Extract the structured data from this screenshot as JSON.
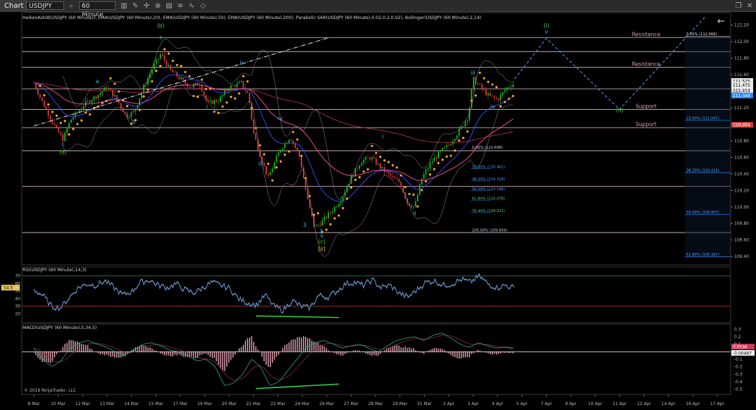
{
  "toolbar": {
    "tab": "Chart",
    "instrument": "USDJPY",
    "interval": "60 Minute",
    "icons": [
      "search-icon",
      "settings-icon",
      "bar-style-icon",
      "draw-icon",
      "crosshair-icon",
      "zoom-icon",
      "template-icon",
      "properties-icon",
      "indicator-icon",
      "strategy-icon",
      "window-icon",
      "close-icon"
    ]
  },
  "colors": {
    "background": "#000000",
    "up": "#1fb81f",
    "down": "#d83a3a",
    "sar": "#f4a62a",
    "ema20": "#3e4cff",
    "ema50": "#ff4f9b",
    "ema200": "#a5334a",
    "bollinger": "#bdbdbd",
    "level": "#f0c8d0",
    "fib_left": "#2f8cff",
    "fib_right": "#2f8cff",
    "projection": "#5f9bff",
    "wave_green": "#3fd23f",
    "wave_cyan": "#33c3e0",
    "wave_yellow": "#e0d23a",
    "rsi": "#4a8fe0",
    "divergence": "#39e04a"
  },
  "chart_data": [
    {
      "type": "candlestick",
      "title": "HeikenAshi8(USDJPY (60 Minute)), EMA(USDJPY (60 Minute),20), EMA(USDJPY (60 Minute),50), EMA(USDJPY (60 Minute),200), Parabolic SAR(USDJPY (60 Minute),0.02,0.2,0.02), Bollinger(USDJPY (60 Minute),2,14)",
      "xlabel": "",
      "ylabel": "",
      "x_ticks": [
        "8 Mar",
        "10 Mar",
        "12 Mar",
        "13 Mar",
        "14 Mar",
        "15 Mar",
        "17 Mar",
        "19 Mar",
        "20 Mar",
        "21 Mar",
        "22 Mar",
        "24 Mar",
        "26 Mar",
        "27 Mar",
        "28 Mar",
        "29 Mar",
        "31 Mar",
        "2 Apr",
        "3 Apr",
        "4 Apr",
        "5 Apr",
        "7 Apr",
        "9 Apr",
        "10 Apr",
        "11 Apr",
        "12 Apr",
        "14 Apr",
        "16 Apr",
        "17 Apr"
      ],
      "y_ticks": [
        112.2,
        112.0,
        111.8,
        111.6,
        111.4,
        111.2,
        111.0,
        110.8,
        110.6,
        110.4,
        110.2,
        110.0,
        109.8,
        109.6,
        109.4
      ],
      "ylim": [
        109.35,
        112.3
      ],
      "price_path": [
        [
          0,
          111.5
        ],
        [
          0.3,
          111.3
        ],
        [
          0.9,
          110.95
        ],
        [
          1.2,
          110.82
        ],
        [
          1.5,
          111.05
        ],
        [
          2.1,
          111.25
        ],
        [
          2.6,
          111.35
        ],
        [
          3.0,
          111.45
        ],
        [
          3.4,
          111.3
        ],
        [
          3.8,
          111.1
        ],
        [
          4.1,
          111.15
        ],
        [
          4.5,
          111.45
        ],
        [
          4.9,
          111.7
        ],
        [
          5.2,
          111.85
        ],
        [
          5.6,
          111.65
        ],
        [
          6.0,
          111.55
        ],
        [
          6.4,
          111.45
        ],
        [
          6.8,
          111.5
        ],
        [
          7.1,
          111.25
        ],
        [
          7.6,
          111.3
        ],
        [
          8.0,
          111.45
        ],
        [
          8.5,
          111.5
        ],
        [
          8.8,
          111.35
        ],
        [
          9.0,
          110.9
        ],
        [
          9.3,
          110.6
        ],
        [
          9.6,
          110.35
        ],
        [
          10.1,
          110.7
        ],
        [
          10.5,
          110.85
        ],
        [
          10.9,
          110.6
        ],
        [
          11.2,
          110.1
        ],
        [
          11.5,
          109.75
        ],
        [
          11.8,
          109.82
        ],
        [
          12.2,
          109.95
        ],
        [
          12.6,
          110.1
        ],
        [
          13.0,
          110.35
        ],
        [
          13.4,
          110.55
        ],
        [
          13.8,
          110.6
        ],
        [
          14.3,
          110.45
        ],
        [
          14.7,
          110.35
        ],
        [
          15.0,
          110.3
        ],
        [
          15.3,
          110.05
        ],
        [
          15.6,
          110.0
        ],
        [
          15.9,
          110.35
        ],
        [
          16.3,
          110.55
        ],
        [
          16.6,
          110.65
        ],
        [
          17.0,
          110.75
        ],
        [
          17.5,
          110.95
        ],
        [
          17.8,
          111.1
        ],
        [
          18.0,
          111.55
        ],
        [
          18.3,
          111.45
        ],
        [
          18.6,
          111.35
        ],
        [
          19.0,
          111.3
        ],
        [
          19.4,
          111.45
        ],
        [
          19.7,
          111.5
        ]
      ],
      "series": [
        {
          "name": "EMA 20",
          "values_ref": "price_path",
          "smoothing": 20
        },
        {
          "name": "EMA 50",
          "values_ref": "price_path",
          "smoothing": 50
        },
        {
          "name": "EMA 200",
          "values_ref": "price_path",
          "smoothing": 200
        }
      ],
      "projection": [
        [
          19.7,
          111.55
        ],
        [
          21.0,
          112.04
        ],
        [
          24.0,
          111.18
        ],
        [
          27.5,
          112.3
        ]
      ],
      "trendline": [
        [
          0,
          110.98
        ],
        [
          12.1,
          112.05
        ]
      ],
      "right_axis_labels": [
        {
          "text": "111.525",
          "value": 111.525,
          "color": "#ffffff"
        },
        {
          "text": "111.475",
          "value": 111.475,
          "color": "#ffffff"
        },
        {
          "text": "111.414",
          "value": 111.414,
          "color": "#ffffff"
        },
        {
          "text": "111.349",
          "value": 111.349,
          "color": "#2f8cff"
        },
        {
          "text": "110.994",
          "value": 110.994,
          "color": "#d83a3a"
        }
      ],
      "levels": [
        {
          "value": 112.05,
          "label": ""
        },
        {
          "value": 111.88,
          "label": ""
        },
        {
          "value": 111.69,
          "label": "Resistance"
        },
        {
          "value": 111.43,
          "label": ""
        },
        {
          "value": 111.18,
          "label": "Support"
        },
        {
          "value": 110.96,
          "label": "Support"
        },
        {
          "value": 110.68,
          "label": ""
        },
        {
          "value": 110.25,
          "label": ""
        },
        {
          "value": 109.69,
          "label": ""
        }
      ],
      "level_text": [
        {
          "text": "Resistance",
          "value": 112.05
        },
        {
          "text": "Resistance",
          "value": 111.69
        },
        {
          "text": "Support",
          "value": 111.18
        },
        {
          "text": "Support",
          "value": 110.96
        }
      ],
      "fib_left": [
        {
          "text": "0.00% (110.698)",
          "value": 110.698
        },
        {
          "text": "23.60% (110.461)",
          "value": 110.461
        },
        {
          "text": "38.20% (110.314)",
          "value": 110.314
        },
        {
          "text": "50.00% (110.196)",
          "value": 110.196
        },
        {
          "text": "61.80% (110.078)",
          "value": 110.078
        },
        {
          "text": "76.40% (109.931)",
          "value": 109.931
        },
        {
          "text": "100.00% (109.694)",
          "value": 109.694
        }
      ],
      "fib_right": [
        {
          "text": "0.00% (112.066)",
          "value": 112.066
        },
        {
          "text": "23.60% (111.047)",
          "value": 111.047
        },
        {
          "text": "38.20% (110.416)",
          "value": 110.416
        },
        {
          "text": "50.00% (109.907)",
          "value": 109.907
        },
        {
          "text": "61.80% (109.397)",
          "value": 109.397
        }
      ],
      "wave_labels": [
        {
          "text": "(b)",
          "x": 5.2,
          "value": 112.17,
          "color": "#3fd23f"
        },
        {
          "text": "c",
          "x": 5.2,
          "value": 112.03,
          "color": "#33c3e0"
        },
        {
          "text": "a",
          "x": 2.6,
          "value": 111.5,
          "color": "#33c3e0"
        },
        {
          "text": "b",
          "x": 4.1,
          "value": 111.01,
          "color": "#33c3e0"
        },
        {
          "text": "c",
          "x": 1.2,
          "value": 110.74,
          "color": "#33c3e0"
        },
        {
          "text": "(a)",
          "x": 1.2,
          "value": 110.64,
          "color": "#3fd23f"
        },
        {
          "text": "ii",
          "x": 8.5,
          "value": 111.72,
          "color": "#33c3e0"
        },
        {
          "text": "i",
          "x": 7.1,
          "value": 111.19,
          "color": "#33c3e0"
        },
        {
          "text": "iii",
          "x": 9.3,
          "value": 110.5,
          "color": "#33c3e0"
        },
        {
          "text": "iv",
          "x": 10.1,
          "value": 111.05,
          "color": "#33c3e0"
        },
        {
          "text": "3",
          "x": 11.1,
          "value": 109.76,
          "color": "#33c3e0"
        },
        {
          "text": "5",
          "x": 11.8,
          "value": 109.68,
          "color": "#33c3e0"
        },
        {
          "text": "v",
          "x": 11.8,
          "value": 109.63,
          "color": "#33c3e0"
        },
        {
          "text": "(c)",
          "x": 11.8,
          "value": 109.56,
          "color": "#3fd23f"
        },
        {
          "text": "[ii]",
          "x": 11.8,
          "value": 109.47,
          "color": "#e0d23a"
        },
        {
          "text": "i",
          "x": 14.3,
          "value": 110.83,
          "color": "#33c3e0"
        },
        {
          "text": "ii",
          "x": 15.6,
          "value": 109.9,
          "color": "#33c3e0"
        },
        {
          "text": "iii",
          "x": 18.0,
          "value": 111.6,
          "color": "#33c3e0"
        },
        {
          "text": "iv",
          "x": 18.8,
          "value": 111.19,
          "color": "#33c3e0"
        },
        {
          "text": "(i)",
          "x": 21.0,
          "value": 112.17,
          "color": "#3fd23f"
        },
        {
          "text": "v",
          "x": 21.0,
          "value": 112.1,
          "color": "#33c3e0"
        },
        {
          "text": "(ii)",
          "x": 24.0,
          "value": 111.15,
          "color": "#3fd23f"
        }
      ]
    },
    {
      "type": "line",
      "title": "RSI(USDJPY (60 Minute),14,3)",
      "y_ticks": [
        70,
        60,
        50,
        40,
        30,
        20
      ],
      "ylim": [
        10,
        80
      ],
      "current_value": "54.5",
      "series": [
        {
          "name": "RSI",
          "values": [
            52,
            45,
            30,
            28,
            42,
            55,
            60,
            58,
            64,
            55,
            45,
            50,
            62,
            65,
            58,
            55,
            60,
            52,
            48,
            55,
            62,
            58,
            54,
            40,
            35,
            32,
            45,
            30,
            25,
            38,
            30,
            28,
            45,
            42,
            50,
            60,
            62,
            58,
            65,
            55,
            58,
            48,
            42,
            52,
            62,
            64,
            58,
            60,
            66,
            62,
            70,
            60,
            55,
            58,
            54
          ]
        }
      ],
      "overbought": 70,
      "oversold": 30,
      "divergence_line": {
        "from": [
          9.1,
          17
        ],
        "to": [
          12.5,
          15
        ]
      }
    },
    {
      "type": "bar",
      "title": "MACD(USDJPY (60 Minute),5,34,5)",
      "y_ticks": [
        0.3,
        0.2,
        0.1,
        0,
        -0.1,
        -0.2,
        -0.3,
        -0.4,
        -0.5
      ],
      "ylim": [
        -0.55,
        0.35
      ],
      "current_values": [
        "0.0596",
        "-0.00467"
      ],
      "series": [
        {
          "name": "MACD",
          "values": [
            0.05,
            -0.1,
            -0.2,
            -0.12,
            0.05,
            0.12,
            0.15,
            0.1,
            0.06,
            0.0,
            -0.05,
            0.02,
            0.1,
            0.12,
            0.08,
            0.02,
            0.0,
            -0.06,
            -0.12,
            -0.1,
            -0.2,
            -0.45,
            -0.42,
            -0.3,
            -0.1,
            -0.2,
            -0.45,
            -0.4,
            -0.25,
            -0.1,
            0.05,
            0.12,
            0.15,
            0.1,
            0.05,
            0.08,
            0.1,
            0.04,
            0.0,
            0.08,
            0.15,
            0.18,
            0.2,
            0.15,
            0.22,
            0.25,
            0.18,
            0.1,
            0.06,
            0.12,
            0.08,
            0.05,
            0.06,
            0.04
          ]
        }
      ],
      "divergence_line": {
        "from": [
          9.1,
          -0.49
        ],
        "to": [
          12.5,
          -0.43
        ]
      }
    }
  ],
  "copyright": "© 2019 NinjaTrader, LLC"
}
